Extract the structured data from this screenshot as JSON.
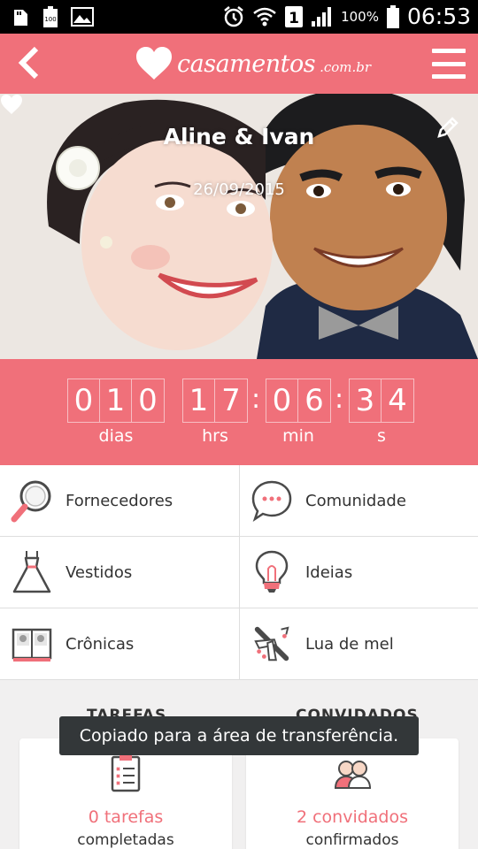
{
  "status_bar": {
    "battery_percent": "100%",
    "time": "06:53",
    "sim_label": "1",
    "icons": [
      "sd-card-icon",
      "battery-100-icon",
      "image-icon",
      "alarm-icon",
      "wifi-icon",
      "sim-1-icon",
      "signal-icon",
      "battery-icon"
    ]
  },
  "app_bar": {
    "logo_text": "casamentos",
    "logo_suffix": ".com.br",
    "back_icon": "back-chevron-icon",
    "menu_icon": "hamburger-menu-icon"
  },
  "hero": {
    "couple_names": "Aline & Ivan",
    "date": "26/09/2015",
    "edit_icon": "pencil-icon"
  },
  "countdown": {
    "days_digits": [
      "0",
      "1",
      "0"
    ],
    "hours_digits": [
      "1",
      "7"
    ],
    "minutes_digits": [
      "0",
      "6"
    ],
    "seconds_digits": [
      "3",
      "4"
    ],
    "labels": {
      "days": "dias",
      "hours": "hrs",
      "minutes": "min",
      "seconds": "s"
    }
  },
  "menu": {
    "items": [
      {
        "label": "Fornecedores",
        "icon": "magnifier-icon"
      },
      {
        "label": "Comunidade",
        "icon": "chat-bubble-icon"
      },
      {
        "label": "Vestidos",
        "icon": "dress-icon"
      },
      {
        "label": "Ideias",
        "icon": "lightbulb-icon"
      },
      {
        "label": "Crônicas",
        "icon": "photo-album-icon"
      },
      {
        "label": "Lua de mel",
        "icon": "airplane-icon"
      }
    ]
  },
  "summary": {
    "tasks": {
      "title": "TAREFAS",
      "value": "0 tarefas",
      "sub": "completadas",
      "icon": "clipboard-icon"
    },
    "guests": {
      "title": "CONVIDADOS",
      "value": "2 convidados",
      "sub": "confirmados",
      "icon": "guests-icon"
    }
  },
  "toast": {
    "message": "Copiado para a área de transferência."
  },
  "colors": {
    "accent": "#f0707a",
    "status_bar": "#000000",
    "toast_bg": "#333739"
  }
}
